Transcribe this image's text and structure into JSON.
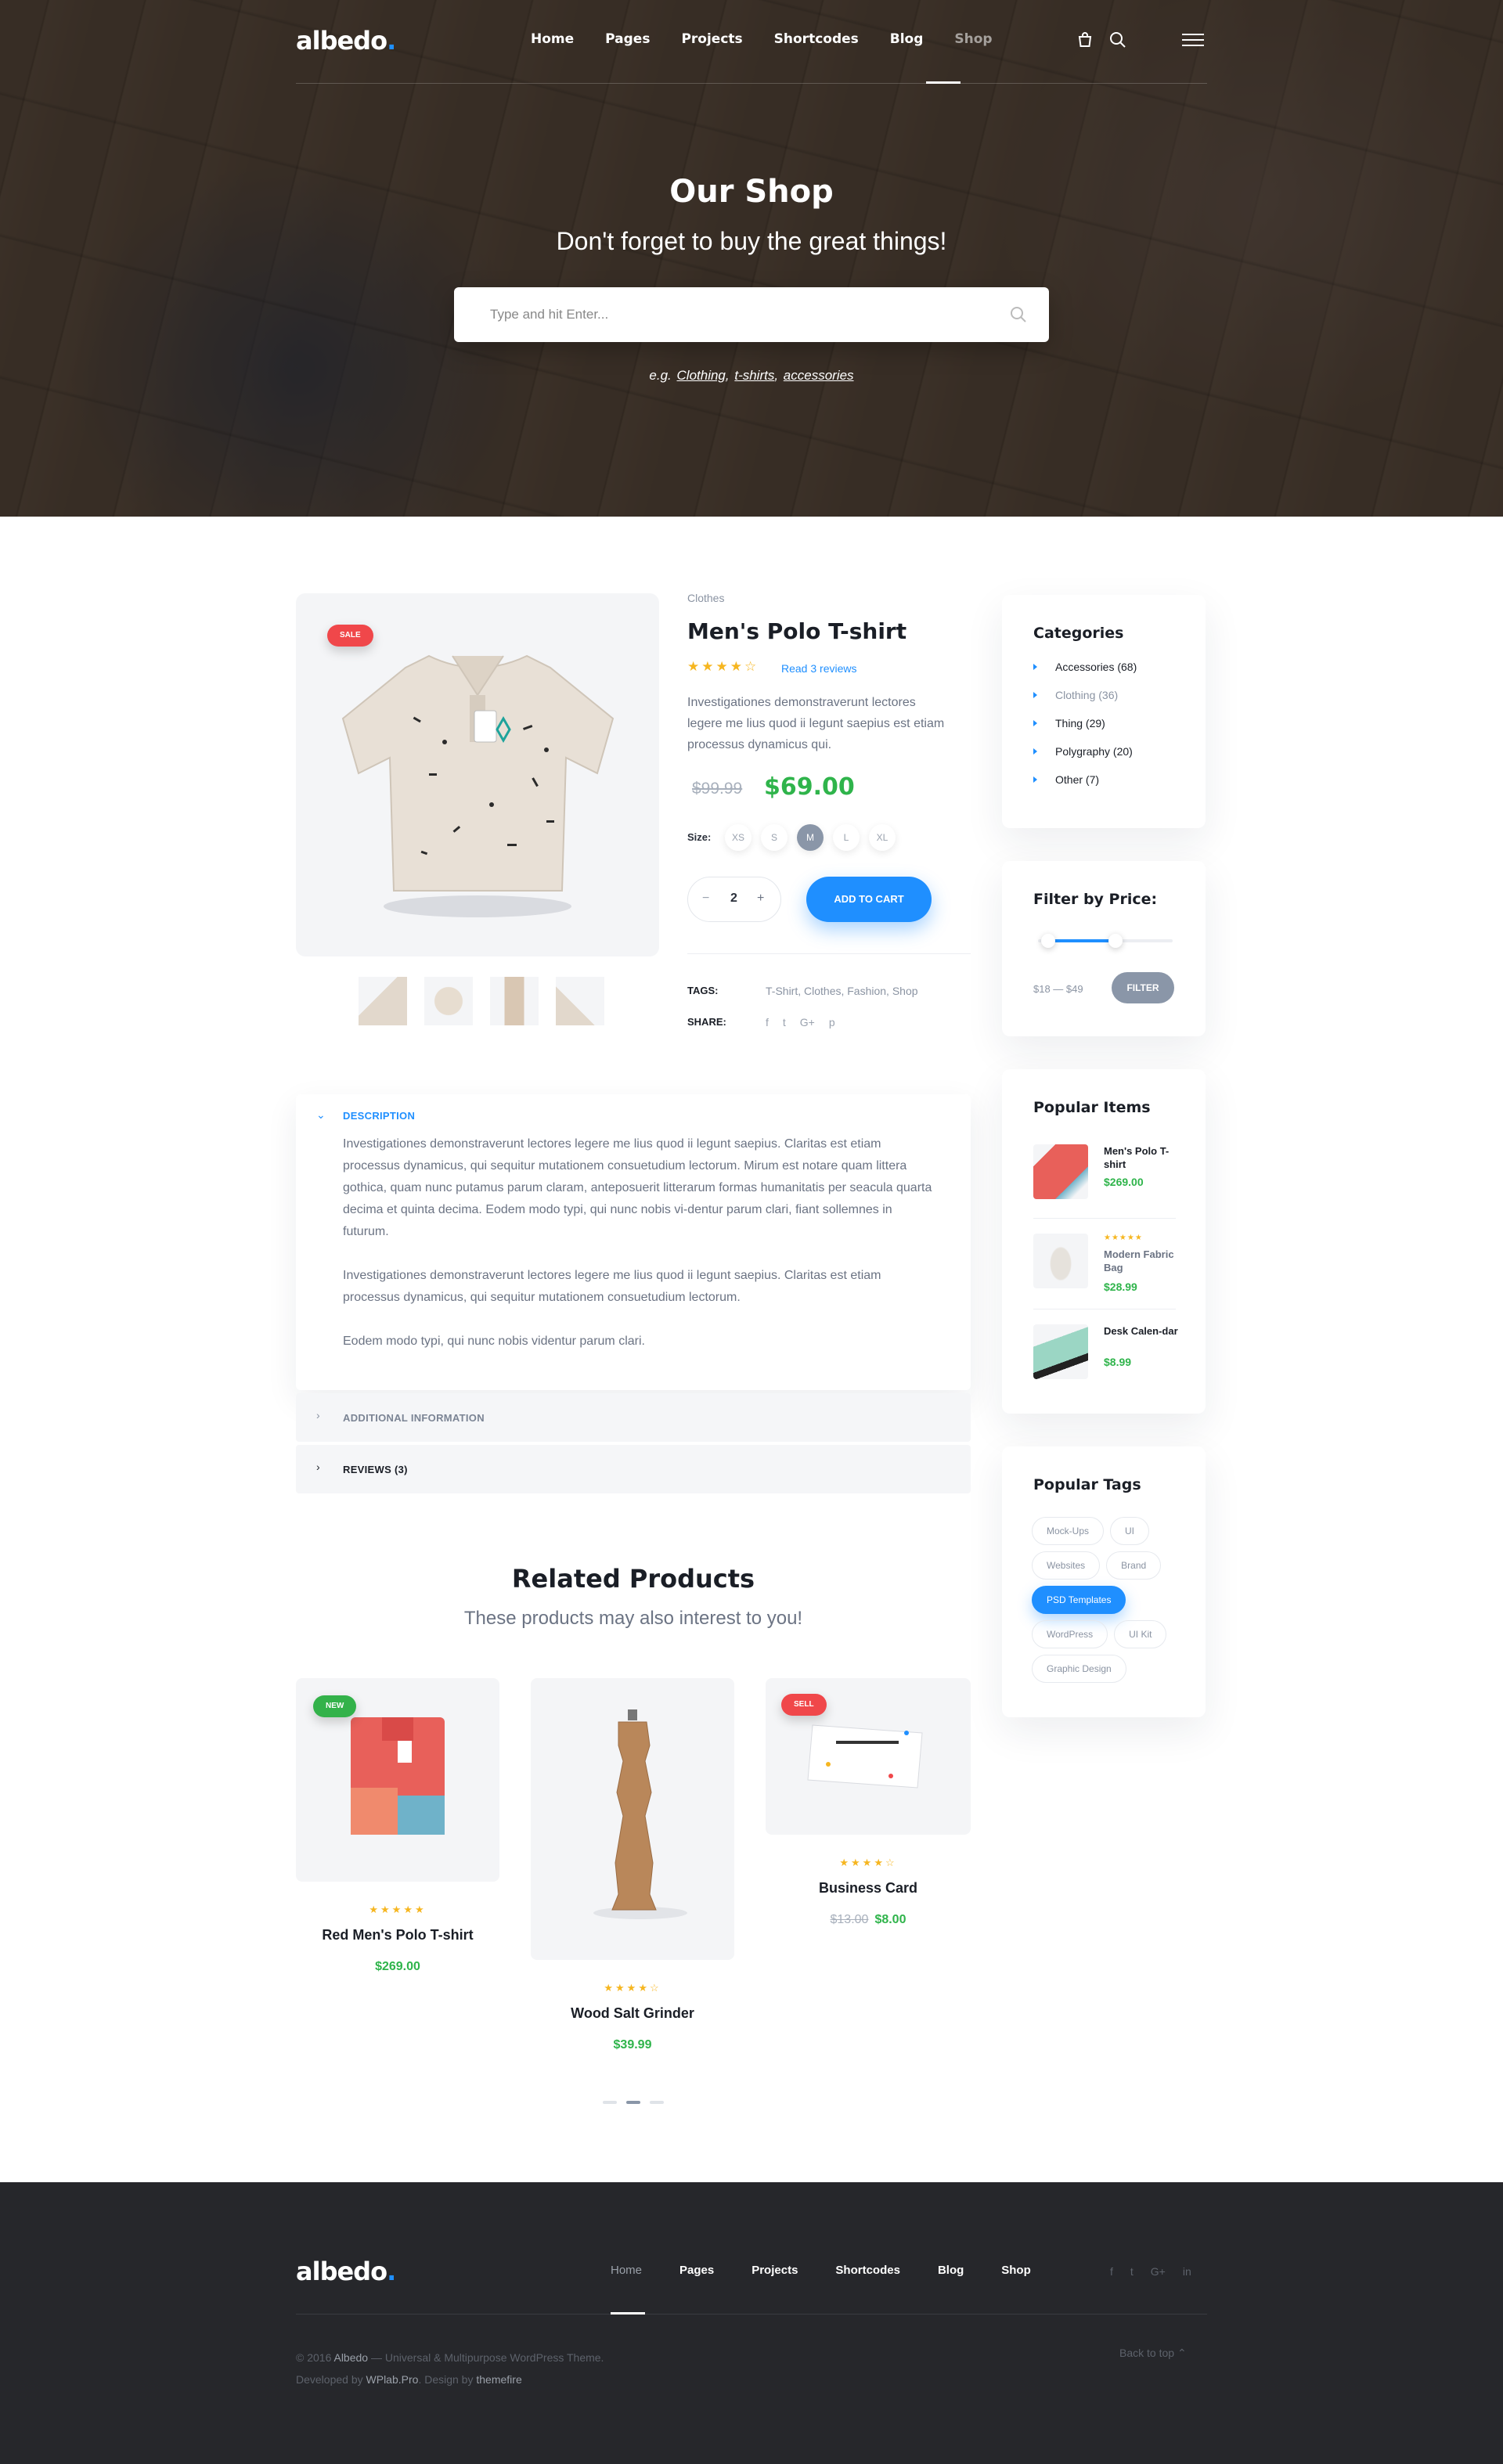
{
  "header": {
    "logo": "albedo",
    "logo_dot": ".",
    "nav": [
      "Home",
      "Pages",
      "Projects",
      "Shortcodes",
      "Blog",
      "Shop"
    ],
    "active_nav": "Shop"
  },
  "hero": {
    "title": "Our Shop",
    "subtitle": "Don't forget to buy the great things!",
    "search_placeholder": "Type and hit Enter...",
    "examples_prefix": "e.g.",
    "examples": [
      "Clothing",
      "t-shirts",
      "accessories"
    ]
  },
  "product": {
    "badge": "SALE",
    "category": "Clothes",
    "title": "Men's Polo T-shirt",
    "rating": 3.5,
    "stars": "★★★★☆",
    "reviews_link": "Read 3 reviews",
    "description": "Investigationes demonstraverunt lectores legere me lius quod ii legunt saepius est etiam processus dynamicus qui.",
    "old_price": "$99.99",
    "price": "$69.00",
    "size_label": "Size:",
    "sizes": [
      "XS",
      "S",
      "M",
      "L",
      "XL"
    ],
    "selected_size": "M",
    "quantity": "2",
    "qty_minus": "−",
    "qty_plus": "+",
    "add_to_cart": "ADD TO CART",
    "tags_label": "TAGS:",
    "tags": "T-Shirt, Clothes, Fashion, Shop",
    "share_label": "SHARE:",
    "share_icons": [
      "facebook-icon",
      "twitter-icon",
      "google-plus-icon",
      "pinterest-icon"
    ]
  },
  "accordion": {
    "description_title": "DESCRIPTION",
    "description_paragraphs": [
      "Investigationes demonstraverunt lectores legere me lius quod ii legunt saepius. Claritas est etiam processus dynamicus, qui sequitur mutationem consuetudium lectorum. Mirum est notare quam littera gothica, quam nunc putamus parum claram, anteposuerit litterarum formas humanitatis per seacula quarta decima et quinta decima. Eodem modo typi, qui nunc nobis vi-dentur parum clari, fiant sollemnes in futurum.",
      "Investigationes demonstraverunt lectores legere me lius quod ii legunt saepius. Claritas est etiam processus dynamicus, qui sequitur mutationem consuetudium lectorum.",
      "Eodem modo typi, qui nunc nobis videntur parum clari."
    ],
    "additional_title": "ADDITIONAL INFORMATION",
    "reviews_title": "REVIEWS (3)"
  },
  "related": {
    "title": "Related Products",
    "subtitle": "These products may also interest to you!",
    "items": [
      {
        "badge": "NEW",
        "name": "Red Men's Polo T-shirt",
        "stars": "★★★★★",
        "price": "$269.00",
        "old_price": ""
      },
      {
        "badge": "",
        "name": "Wood Salt Grinder",
        "stars": "★★★★☆",
        "price": "$39.99",
        "old_price": ""
      },
      {
        "badge": "SELL",
        "name": "Business Card",
        "stars": "★★★★☆",
        "price": "$8.00",
        "old_price": "$13.00"
      }
    ]
  },
  "sidebar": {
    "categories_title": "Categories",
    "categories": [
      "Accessories (68)",
      "Clothing (36)",
      "Thing (29)",
      "Polygraphy (20)",
      "Other (7)"
    ],
    "filter_title": "Filter by Price:",
    "price_range": "$18 — $49",
    "filter_button": "FILTER",
    "popular_title": "Popular Items",
    "popular_items": [
      {
        "name": "Men's Polo T-shirt",
        "stars": "",
        "price": "$269.00"
      },
      {
        "name": "Modern Fabric Bag",
        "stars": "★★★★★",
        "price": "$28.99"
      },
      {
        "name": "Desk Calen-dar",
        "stars": "",
        "price": "$8.99"
      }
    ],
    "tags_title": "Popular Tags",
    "tags": [
      "Mock-Ups",
      "UI",
      "Websites",
      "Brand",
      "PSD Templates",
      "WordPress",
      "UI Kit",
      "Graphic Design"
    ],
    "active_tag": "PSD Templates"
  },
  "footer": {
    "logo": "albedo",
    "nav": [
      "Home",
      "Pages",
      "Projects",
      "Shortcodes",
      "Blog",
      "Shop"
    ],
    "active_nav": "Home",
    "social": [
      "f",
      "t",
      "G+",
      "in"
    ],
    "copyright_prefix": "© 2016",
    "copyright_brand": "Albedo",
    "copyright_suffix": "— Universal & Multipurpose WordPress Theme.",
    "developed_prefix": "Developed by",
    "developer": "WPlab.Pro",
    "design_prefix": ". Design by",
    "designer": "themefire",
    "back_to_top": "Back to top"
  },
  "colors": {
    "accent": "#1f8fff",
    "price": "#2fb44b",
    "sale": "#f0474a",
    "new": "#33b24a",
    "star": "#f6b620",
    "footer_bg": "#26272b"
  }
}
